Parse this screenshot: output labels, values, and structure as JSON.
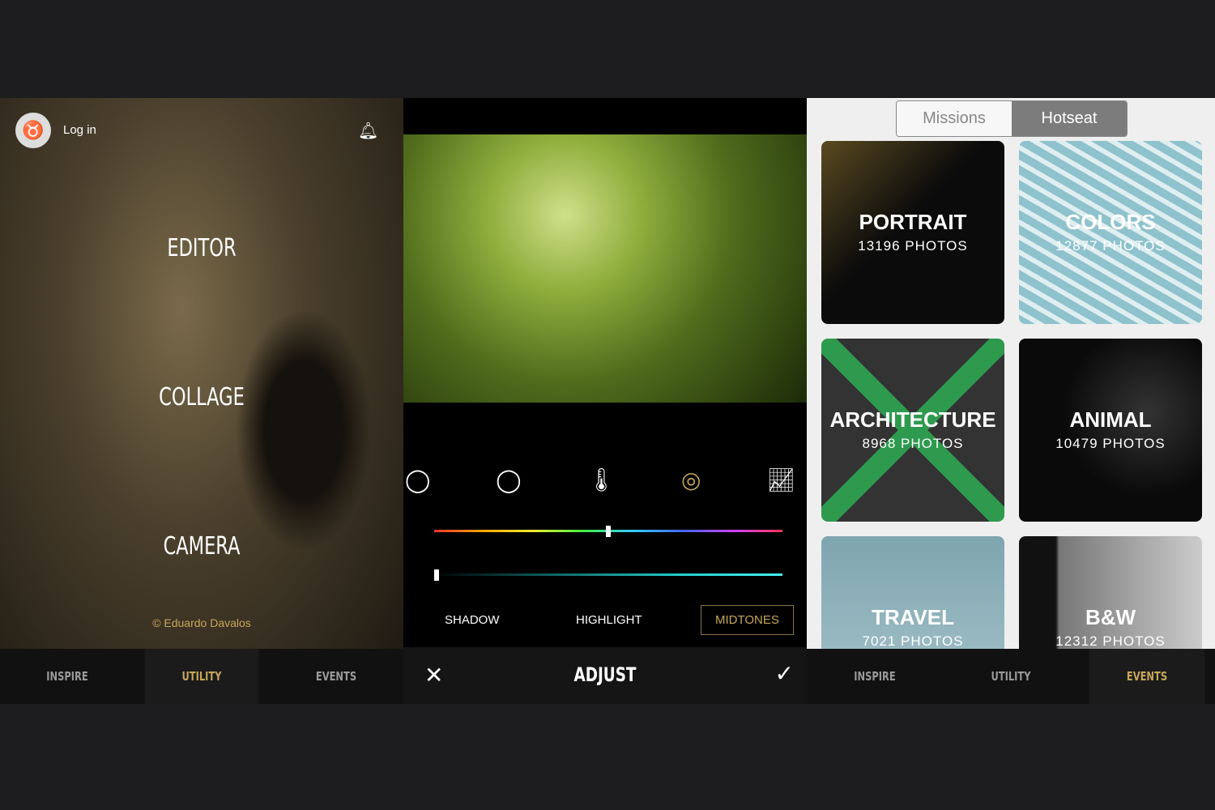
{
  "home": {
    "login": "Log in",
    "menu": [
      "EDITOR",
      "COLLAGE",
      "CAMERA"
    ],
    "credit": "© Eduardo Davalos",
    "tabs": [
      "INSPIRE",
      "UTILITY",
      "EVENTS"
    ],
    "active_tab": "UTILITY"
  },
  "adjust": {
    "tools": [
      "hsl-icon",
      "vignette-icon",
      "temperature-icon",
      "selective-icon",
      "curves-icon"
    ],
    "active_tool": "selective-icon",
    "hue_value": 0.5,
    "tone_value": 0.0,
    "modes": [
      "SHADOW",
      "HIGHLIGHT",
      "MIDTONES"
    ],
    "active_mode": "MIDTONES",
    "title": "ADJUST",
    "cancel": "✕",
    "confirm": "✓"
  },
  "events": {
    "segments": [
      "Missions",
      "Hotseat"
    ],
    "active_segment": "Hotseat",
    "cards": [
      {
        "name": "PORTRAIT",
        "count": "13196 PHOTOS"
      },
      {
        "name": "COLORS",
        "count": "12877 PHOTOS"
      },
      {
        "name": "ARCHITECTURE",
        "count": "8968 PHOTOS"
      },
      {
        "name": "ANIMAL",
        "count": "10479 PHOTOS"
      },
      {
        "name": "TRAVEL",
        "count": "7021 PHOTOS"
      },
      {
        "name": "B&W",
        "count": "12312 PHOTOS"
      }
    ],
    "tabs": [
      "INSPIRE",
      "UTILITY",
      "EVENTS"
    ],
    "active_tab": "EVENTS"
  },
  "colors": {
    "accent": "#c6a75a"
  }
}
